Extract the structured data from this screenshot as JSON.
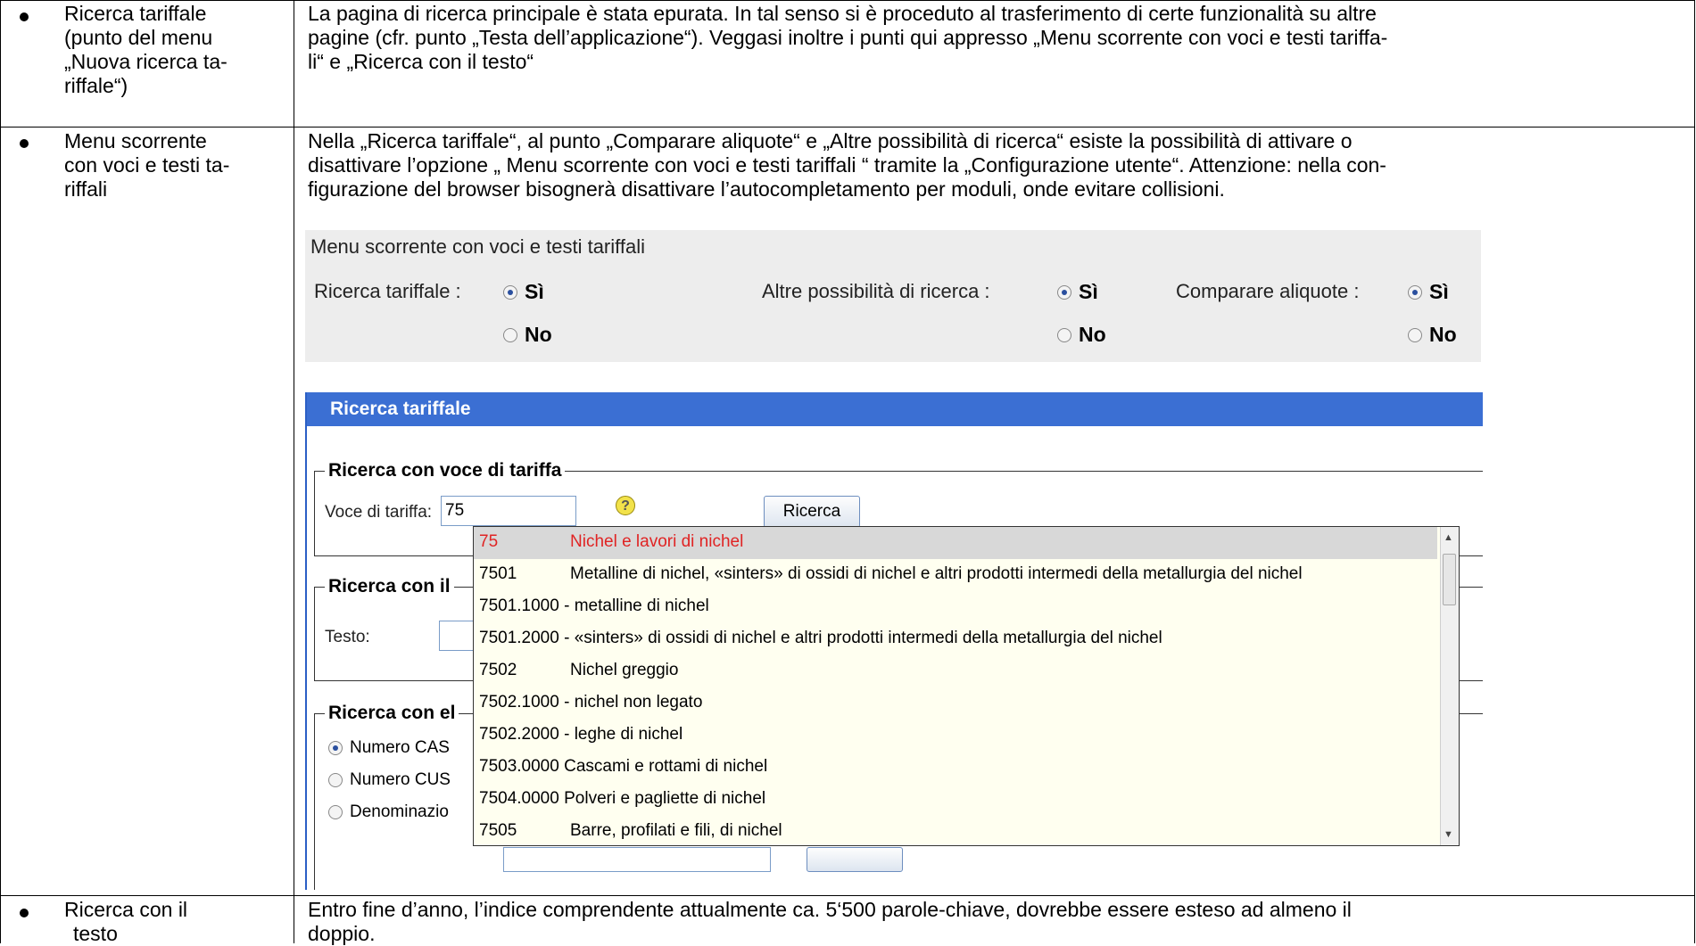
{
  "rows": [
    {
      "label_lines": [
        "Ricerca tariffale",
        "(punto del  menu",
        "„Nuova ricerca ta-",
        "riffale“)"
      ],
      "text_lines": [
        "La pagina di ricerca principale è stata epurata. In tal senso si è proceduto al trasferimento di certe funzionalità su altre",
        "pagine (cfr. punto „Testa dell’applicazione“). Veggasi inoltre i punti qui appresso „Menu scorrente con voci e testi tariffa-",
        "li“ e „Ricerca con il testo“"
      ]
    },
    {
      "label_lines": [
        "Menu scorrente",
        "con voci e testi ta-",
        "riffali"
      ],
      "text_lines": [
        "Nella „Ricerca tariffale“, al punto „Comparare aliquote“ e „Altre possibilità di ricerca“ esiste la possibilità di attivare o",
        "disattivare l’opzione „ Menu scorrente con voci e testi tariffali “ tramite la „Configurazione utente“. Attenzione: nella con-",
        "figurazione del browser bisognerà disattivare l’autocompletamento per moduli, onde evitare collisioni."
      ]
    },
    {
      "label_lines": [
        "Ricerca con il",
        "testo"
      ],
      "text_lines": [
        "Entro fine d’anno, l’indice comprendente attualmente ca. 5‘500 parole-chiave, dovrebbe essere esteso ad almeno il",
        "doppio."
      ]
    }
  ],
  "config_panel": {
    "title": "Menu scorrente con voci e testi tariffali",
    "groups": [
      {
        "label": "Ricerca tariffale :",
        "yes": "Sì",
        "no": "No",
        "selected": "yes"
      },
      {
        "label": "Altre possibilità di ricerca :",
        "yes": "Sì",
        "no": "No",
        "selected": "yes"
      },
      {
        "label": "Comparare aliquote :",
        "yes": "Sì",
        "no": "No",
        "selected": "yes"
      }
    ]
  },
  "app": {
    "header": "Ricerca tariffale",
    "fs_voce": {
      "legend": "Ricerca con voce di tariffa",
      "label": "Voce di tariffa:",
      "value": "75",
      "button": "Ricerca"
    },
    "fs_testo": {
      "legend": "Ricerca con il",
      "label": "Testo:"
    },
    "fs_el": {
      "legend": "Ricerca con el",
      "options": [
        "Numero CAS",
        "Numero CUS",
        "Denominazio"
      ]
    },
    "dropdown": [
      {
        "code": "75",
        "desc": "Nichel e lavori di nichel",
        "highlight": true
      },
      {
        "code": "7501",
        "desc": "Metalline di nichel, «sinters» di ossidi di nichel e altri prodotti intermedi della metallurgia del nichel"
      },
      {
        "code": "7501.1000",
        "desc": "- metalline di nichel",
        "inline": true
      },
      {
        "code": "7501.2000",
        "desc": "- «sinters» di ossidi di nichel e altri prodotti intermedi della metallurgia del nichel",
        "inline": true
      },
      {
        "code": "7502",
        "desc": "Nichel greggio"
      },
      {
        "code": "7502.1000",
        "desc": "- nichel non legato",
        "inline": true
      },
      {
        "code": "7502.2000",
        "desc": "- leghe di nichel",
        "inline": true
      },
      {
        "code": "7503.0000",
        "desc": "Cascami e rottami di nichel",
        "inline": true
      },
      {
        "code": "7504.0000",
        "desc": "Polveri e pagliette di nichel",
        "inline": true
      },
      {
        "code": "7505",
        "desc": "Barre, profilati e fili, di nichel"
      }
    ]
  }
}
